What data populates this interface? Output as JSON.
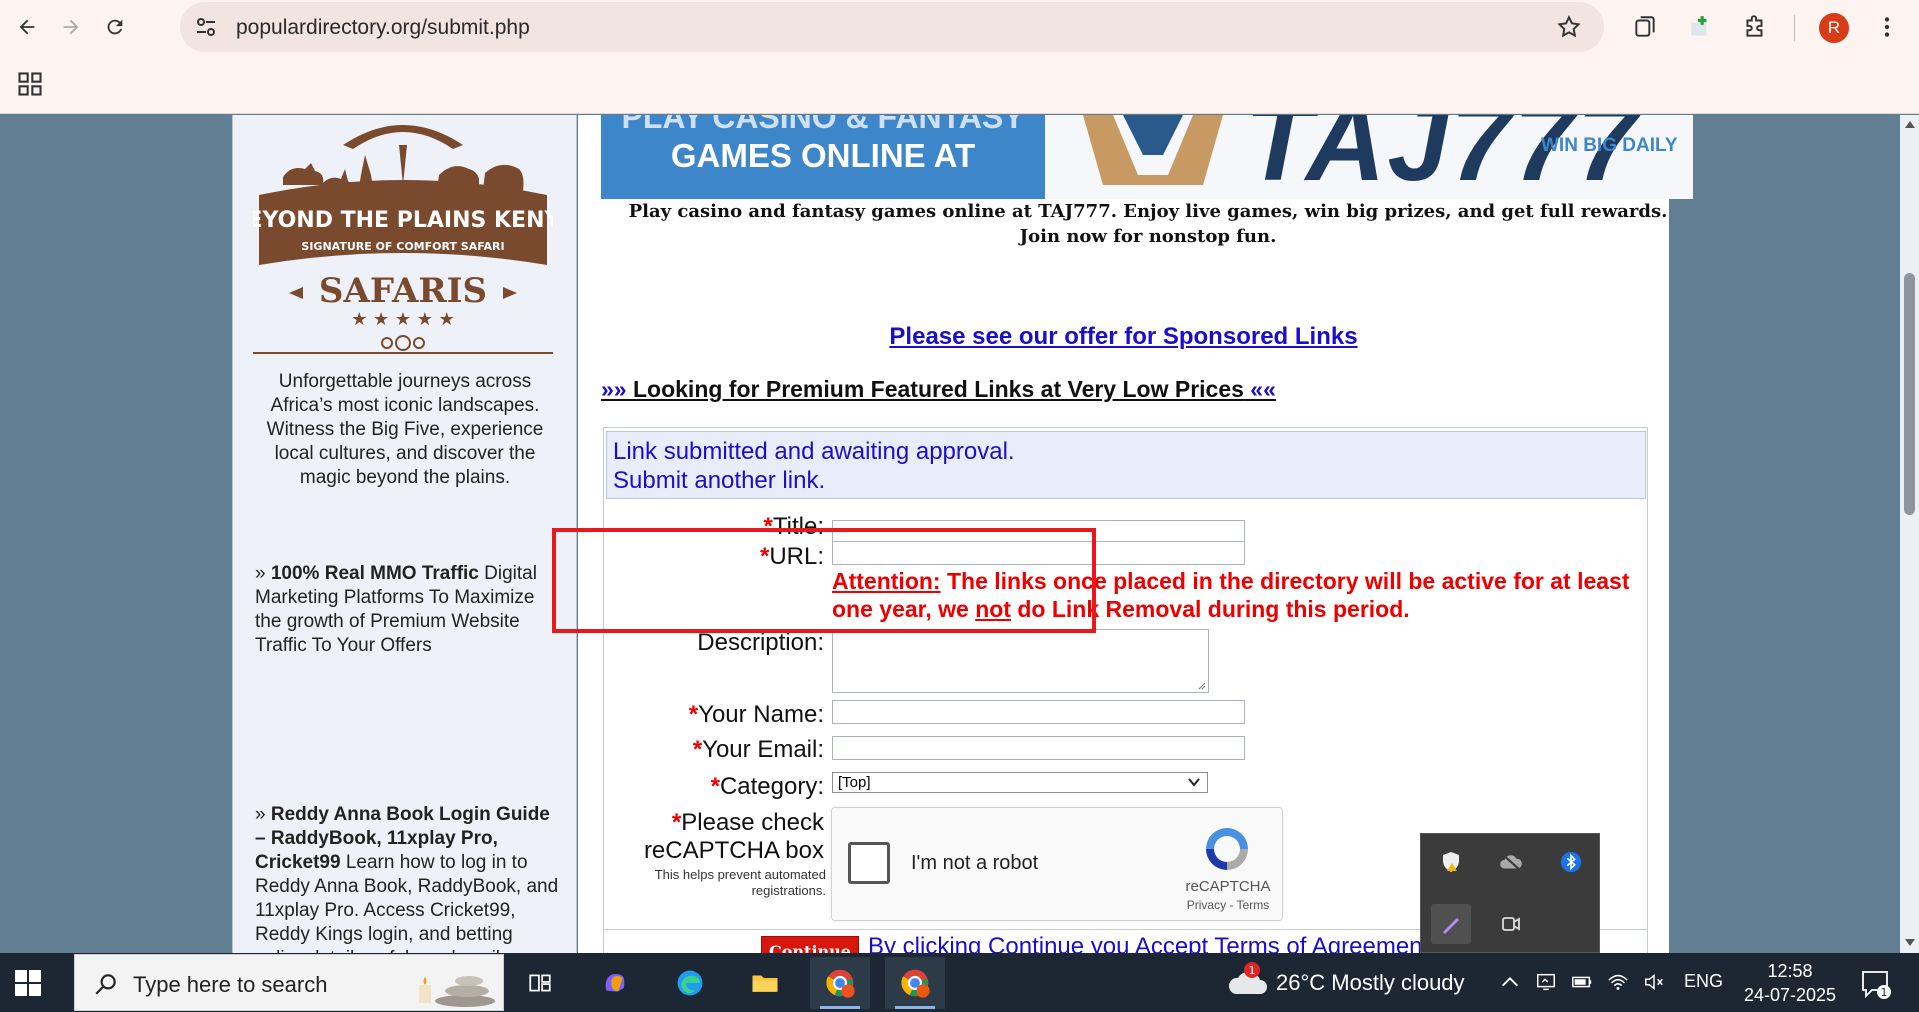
{
  "browser": {
    "url": "populardirectory.org/submit.php",
    "avatar_letter": "R"
  },
  "sidebar": {
    "logo_text": {
      "line1": "BEYOND THE PLAINS KENYA",
      "line2": "SIGNATURE OF COMFORT SAFARI",
      "line3": "SAFARIS"
    },
    "description": "Unforgettable journeys across Africa’s most iconic landscapes. Witness the Big Five, experience local cultures, and discover the magic beyond the plains.",
    "items": [
      {
        "prefix": "» ",
        "title": "100% Real MMO Traffic",
        "text": " Digital Marketing Platforms To Maximize the growth of Premium Website Traffic To Your Offers"
      },
      {
        "prefix": "» ",
        "title": "Reddy Anna Book Login Guide – RaddyBook, 11xplay Pro, Cricket99",
        "text": " Learn how to log in to Reddy Anna Book, RaddyBook, and 11xplay Pro. Access Cricket99, Reddy Kings login, and betting policy details safely and easily."
      }
    ]
  },
  "banner": {
    "left_line1": "PLAY CASINO & FANTASY",
    "left_line2": "GAMES ONLINE AT",
    "brand": "TAJ777",
    "tagline": "WIN BIG DAILY",
    "caption": "Play casino and fantasy games online at TAJ777. Enjoy live games, win big prizes, and get full rewards. Join now for nonstop fun."
  },
  "main": {
    "sponsored_link": "Please see our offer for Sponsored Links",
    "premium_prefix": "»» ",
    "premium_text": "Looking for Premium Featured Links at Very Low Prices",
    "premium_suffix": " ««",
    "notice_line1": "Link submitted and awaiting approval.",
    "notice_line2": "Submit another link."
  },
  "form": {
    "required_mark": "*",
    "title_label": "Title:",
    "url_label": "URL:",
    "attention_label": "Attention:",
    "attention_text_1": " The links once placed in the directory will be active for at least one year, we ",
    "attention_not": "not",
    "attention_text_2": " do Link Removal during this period.",
    "description_label": "Description:",
    "name_label": "Your Name:",
    "email_label": "Your Email:",
    "category_label": "Category:",
    "category_value": "[Top]",
    "captcha_label_1": "Please check",
    "captcha_label_2": "reCAPTCHA box",
    "captcha_help": "This helps prevent automated registrations.",
    "recaptcha_text": "I'm not a robot",
    "recaptcha_brand": "reCAPTCHA",
    "recaptcha_terms": "Privacy - Terms",
    "continue_label": "Continue",
    "terms_text": "By clicking Continue you Accept Terms of Agreement"
  },
  "taskbar": {
    "search_placeholder": "Type here to search",
    "weather": "26°C  Mostly cloudy",
    "weather_badge": "1",
    "language": "ENG",
    "time": "12:58",
    "date": "24-07-2025",
    "notification_count": "1"
  },
  "colors": {
    "accent_red": "#e8191d",
    "link_blue": "#1a0dcc",
    "brand_brown": "#7a4a2e"
  }
}
